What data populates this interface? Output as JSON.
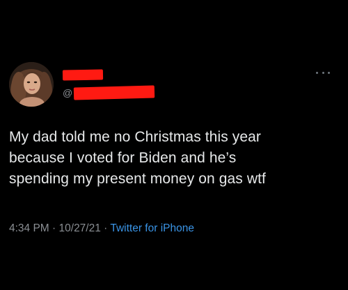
{
  "tweet": {
    "handle_prefix": "@",
    "text_lines": [
      "My dad told me no Christmas this year",
      "because I voted for Biden and he’s",
      "spending my present money on gas wtf"
    ],
    "time": "4:34 PM",
    "separator": " · ",
    "date": "10/27/21",
    "source": "Twitter for iPhone"
  },
  "icons": {
    "more": "more-horizontal-icon"
  },
  "colors": {
    "background": "#000000",
    "text": "#e7e9ea",
    "secondary_text": "#8b8f94",
    "link": "#3a94e6",
    "redaction": "#ff1a12"
  }
}
